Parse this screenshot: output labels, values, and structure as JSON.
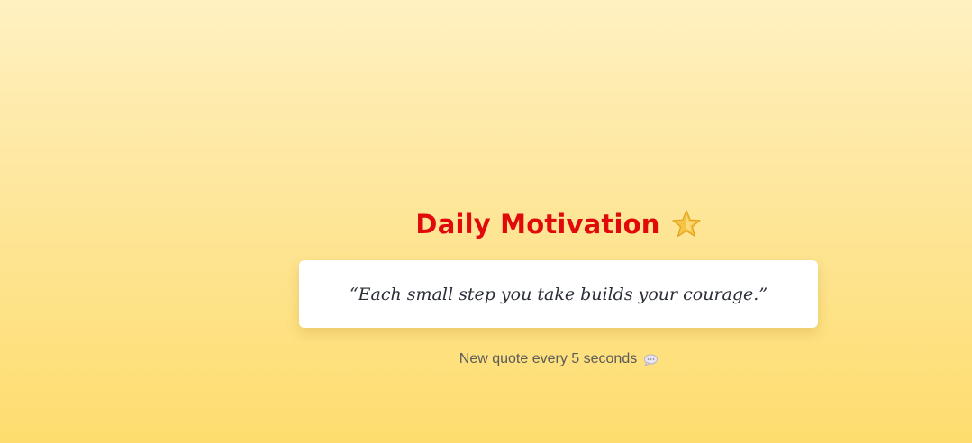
{
  "header": {
    "title": "Daily Motivation",
    "icon": "star-icon"
  },
  "quote": {
    "text": "“Each small step you take builds your courage.”"
  },
  "footer": {
    "text": "New quote every 5 seconds",
    "icon": "speech-bubble-icon"
  },
  "colors": {
    "title": "#e00a0a",
    "background_top": "#fff1c1",
    "background_bottom": "#fedd6e",
    "card": "#ffffff",
    "quote_text": "#2b2f3a",
    "footer_text": "#5a5a5a"
  }
}
